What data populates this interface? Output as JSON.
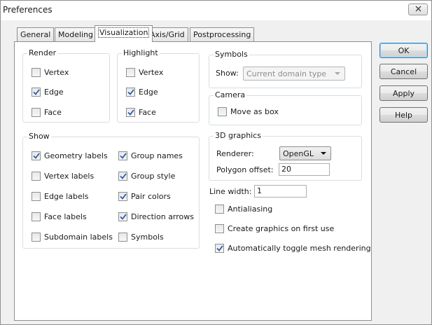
{
  "window": {
    "title": "Preferences"
  },
  "tabs": [
    "General",
    "Modeling",
    "Visualization",
    "Axis/Grid",
    "Postprocessing"
  ],
  "active_tab": "Visualization",
  "render": {
    "label": "Render",
    "items": [
      {
        "label": "Vertex",
        "checked": false
      },
      {
        "label": "Edge",
        "checked": true
      },
      {
        "label": "Face",
        "checked": false
      }
    ]
  },
  "highlight": {
    "label": "Highlight",
    "items": [
      {
        "label": "Vertex",
        "checked": false
      },
      {
        "label": "Edge",
        "checked": true
      },
      {
        "label": "Face",
        "checked": true
      }
    ]
  },
  "show": {
    "label": "Show",
    "left_items": [
      {
        "label": "Geometry labels",
        "checked": true
      },
      {
        "label": "Vertex labels",
        "checked": false
      },
      {
        "label": "Edge labels",
        "checked": false
      },
      {
        "label": "Face labels",
        "checked": false
      },
      {
        "label": "Subdomain labels",
        "checked": false
      }
    ],
    "right_items": [
      {
        "label": "Group names",
        "checked": true
      },
      {
        "label": "Group style",
        "checked": true
      },
      {
        "label": "Pair colors",
        "checked": true
      },
      {
        "label": "Direction arrows",
        "checked": true
      },
      {
        "label": "Symbols",
        "checked": false
      }
    ]
  },
  "symbols": {
    "label": "Symbols",
    "show_label": "Show:",
    "show_value": "Current domain type"
  },
  "camera": {
    "label": "Camera",
    "move_as_box": {
      "label": "Move as box",
      "checked": false
    }
  },
  "graphics_3d": {
    "label": "3D graphics",
    "renderer_label": "Renderer:",
    "renderer_value": "OpenGL",
    "polygon_offset_label": "Polygon offset:",
    "polygon_offset_value": "20"
  },
  "line_width": {
    "label": "Line width:",
    "value": "1"
  },
  "options": [
    {
      "label": "Antialiasing",
      "checked": false
    },
    {
      "label": "Create graphics on first use",
      "checked": false
    },
    {
      "label": "Automatically toggle mesh rendering",
      "checked": true
    }
  ],
  "buttons": {
    "ok": "OK",
    "cancel": "Cancel",
    "apply": "Apply",
    "help": "Help"
  },
  "colors": {
    "check_mark": "#2a5db0",
    "group_border": "#d5dfe5",
    "default_button_border": "#3c7fb1"
  },
  "icons": {
    "close": "close-x-icon",
    "check": "check-mark-icon"
  }
}
